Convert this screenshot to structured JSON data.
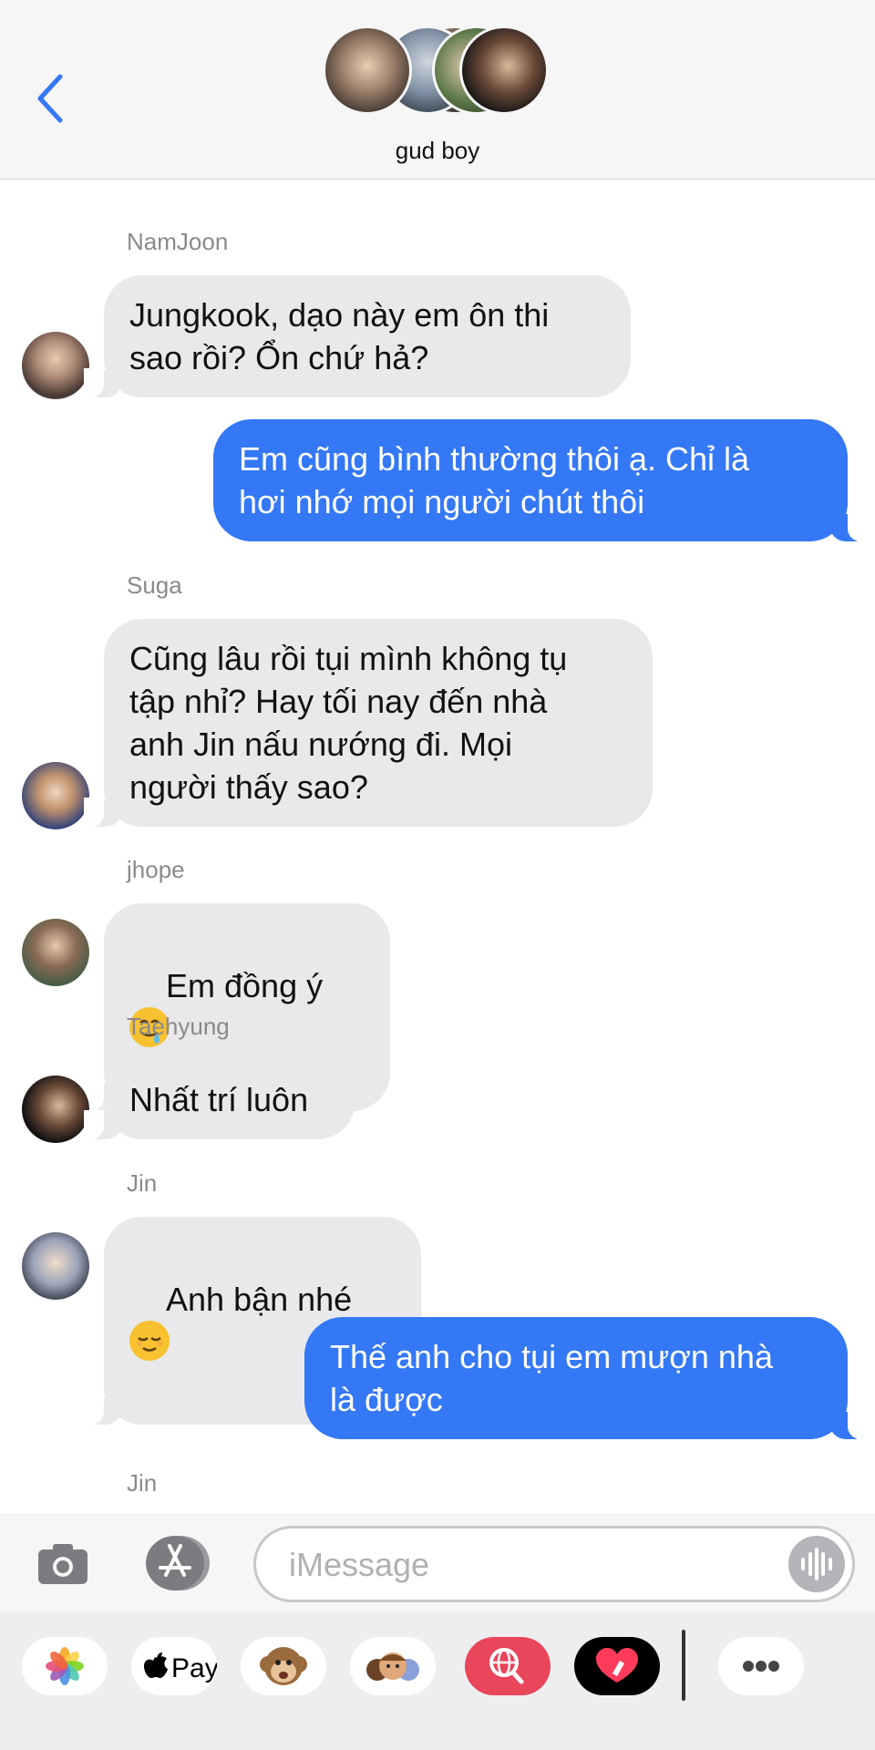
{
  "header": {
    "group_name": "gud boy"
  },
  "messages": [
    {
      "sender": "NamJoon",
      "text": "Jungkook, dạo này em ôn thi\nsao rồi? Ổn chứ hả?"
    },
    {
      "text": "Em cũng bình thường thôi ạ. Chỉ là\nhơi nhớ mọi người chút thôi"
    },
    {
      "sender": "Suga",
      "text": "Cũng lâu rồi tụi mình không tụ\ntập nhỉ? Hay tối nay đến nhà\nanh Jin nấu nướng đi. Mọi\nngười thấy sao?"
    },
    {
      "sender": "jhope",
      "text": "Em đồng ý "
    },
    {
      "sender": "Taehyung",
      "text": "Nhất trí luôn"
    },
    {
      "sender": "Jin",
      "text": "Anh bận nhé "
    },
    {
      "text": "Thế anh cho tụi em mượn nhà\nlà được"
    },
    {
      "sender": "Jin"
    }
  ],
  "input": {
    "placeholder": "iMessage"
  },
  "apps": {
    "apple_pay_label": "Pay"
  },
  "colors": {
    "accent": "#3478f6",
    "incoming": "#e9e9eb",
    "background": "#ffffff"
  }
}
